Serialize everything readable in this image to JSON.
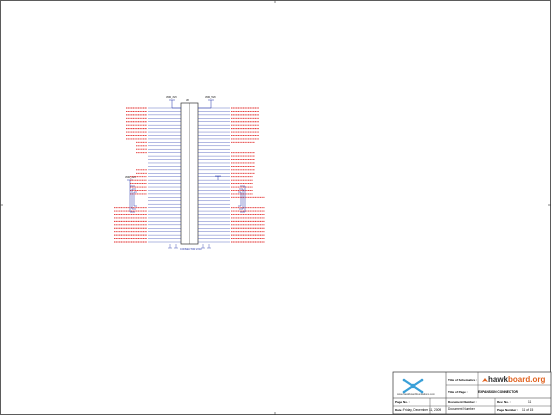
{
  "titleblock": {
    "title_of_schematics_label": "Title of Schematics :",
    "title_of_page_label": "Title of Page :",
    "page_title": "EXPANSION CONNECTOR",
    "page_no_label": "Page No. :",
    "page_no": "11",
    "document_number_label": "Document Number :",
    "document_number": "Document Number",
    "rev_no_label": "Rev. No. :",
    "date_label": "Date :",
    "date": "Friday, December 11, 2009",
    "page_count_label": "Page Number :",
    "page_count": "11  of  15",
    "brand_prefix": "hawk",
    "brand_suffix": "board.org",
    "website": "www.hawkboardfoundations.com"
  },
  "connector": {
    "refdes": "J8",
    "part": "CONNECTOR 2X40",
    "left_power": "VDD_3V3",
    "right_power": "VDD_5V0",
    "mid_power": "VDD_3V3"
  },
  "colors": {
    "net": "#e02828",
    "wire": "#2233aa",
    "border": "#333333",
    "logo": "#3aa0d8",
    "brand_accent": "#e0621f"
  }
}
